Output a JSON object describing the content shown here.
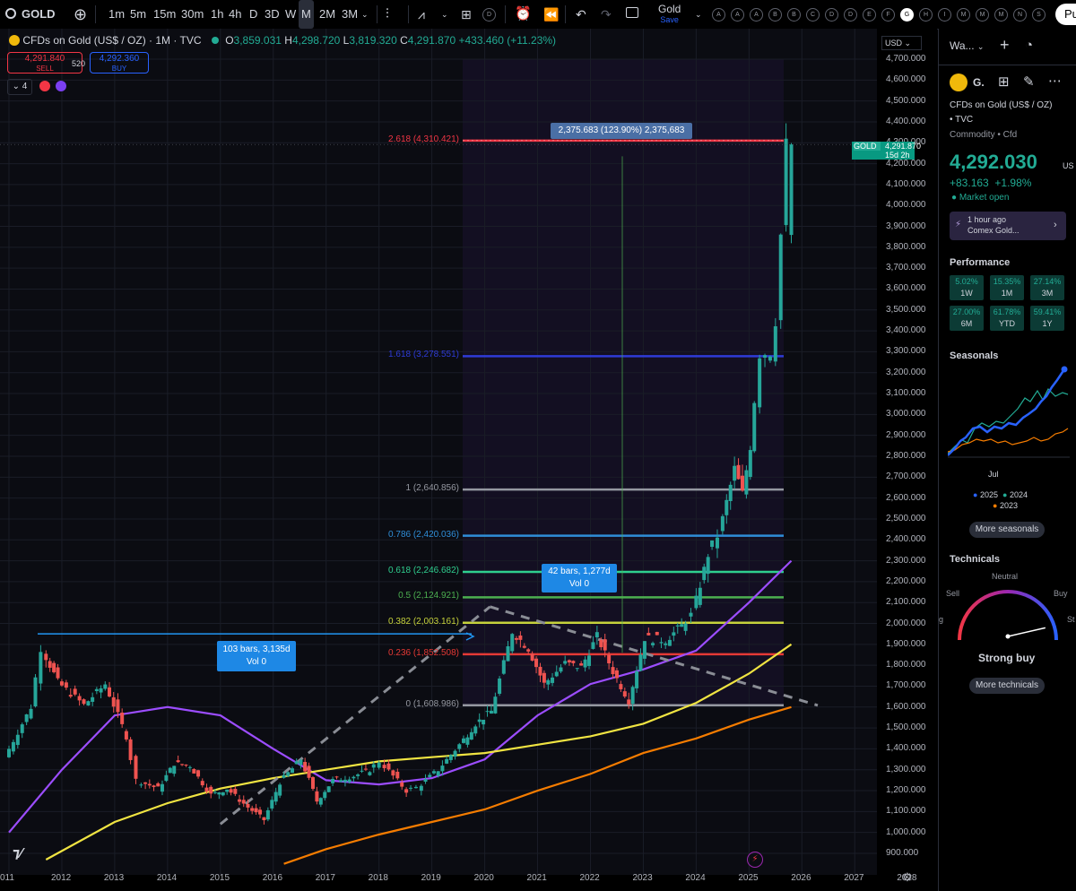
{
  "toolbar": {
    "symbol": "GOLD",
    "intervals": [
      "1m",
      "5m",
      "15m",
      "30m",
      "1h",
      "4h",
      "D",
      "3D",
      "W",
      "M",
      "2M",
      "3M"
    ],
    "active_interval": "M",
    "layout_name": "Gold",
    "layout_status": "Save",
    "alerts_letters": [
      "A",
      "A",
      "A",
      "B",
      "B",
      "C",
      "D",
      "D",
      "E",
      "F",
      "G",
      "H",
      "I",
      "M",
      "M",
      "M",
      "N",
      "S"
    ],
    "active_alert": "G",
    "publish_label": "Pul"
  },
  "legend": {
    "title": "CFDs on Gold (US$ / OZ) · 1M · TVC",
    "o_label": "O",
    "o": "3,859.031",
    "h_label": "H",
    "h": "4,298.720",
    "l_label": "L",
    "l": "3,819.320",
    "c_label": "C",
    "c": "4,291.870",
    "change": "+433.460 (+11.23%)",
    "sell_price": "4,291.840",
    "sell_label": "SELL",
    "spread": "520",
    "buy_price": "4,292.360",
    "buy_label": "BUY",
    "indicator_count": "4"
  },
  "currency": "USD",
  "price_axis": [
    "4,700.000",
    "4,600.000",
    "4,500.000",
    "4,400.000",
    "4,300.000",
    "4,200.000",
    "4,100.000",
    "4,000.000",
    "3,900.000",
    "3,800.000",
    "3,700.000",
    "3,600.000",
    "3,500.000",
    "3,400.000",
    "3,300.000",
    "3,200.000",
    "3,100.000",
    "3,000.000",
    "2,900.000",
    "2,800.000",
    "2,700.000",
    "2,600.000",
    "2,500.000",
    "2,400.000",
    "2,300.000",
    "2,200.000",
    "2,100.000",
    "2,000.000",
    "1,900.000",
    "1,800.000",
    "1,700.000",
    "1,600.000",
    "1,500.000",
    "1,400.000",
    "1,300.000",
    "1,200.000",
    "1,100.000",
    "1,000.000",
    "900.000"
  ],
  "time_axis": [
    "011",
    "2012",
    "2013",
    "2014",
    "2015",
    "2016",
    "2017",
    "2018",
    "2019",
    "2020",
    "2021",
    "2022",
    "2023",
    "2024",
    "2025",
    "2026",
    "2027",
    "2028"
  ],
  "current_price_tag": {
    "symbol": "GOLD",
    "price": "4,291.870",
    "countdown": "15d 2h"
  },
  "fib_levels": [
    {
      "label": "2.618 (4,310.421)",
      "price": 4310.421,
      "color": "#f23645"
    },
    {
      "label": "1.618 (3,278.551)",
      "price": 3278.551,
      "color": "#2e3bd6"
    },
    {
      "label": "1 (2,640.856)",
      "price": 2640.856,
      "color": "#9598a1"
    },
    {
      "label": "0.786 (2,420.036)",
      "price": 2420.036,
      "color": "#2f8ed8"
    },
    {
      "label": "0.618 (2,246.682)",
      "price": 2246.682,
      "color": "#2fcf8f"
    },
    {
      "label": "0.5 (2,124.921)",
      "price": 2124.921,
      "color": "#4caf50"
    },
    {
      "label": "0.382 (2,003.161)",
      "price": 2003.161,
      "color": "#c6d23b"
    },
    {
      "label": "0.236 (1,852.508)",
      "price": 1852.508,
      "color": "#e53935"
    },
    {
      "label": "0 (1,608.986)",
      "price": 1608.986,
      "color": "#9598a1"
    }
  ],
  "measure_top": "2,375.683 (123.90%) 2,375,683",
  "measure_mid": {
    "line1": "42 bars, 1,277d",
    "line2": "Vol 0"
  },
  "measure_left": {
    "line1": "103 bars, 3,135d",
    "line2": "Vol 0"
  },
  "chart_data": {
    "type": "candlestick",
    "interval": "1M",
    "ylim": [
      850,
      4780
    ],
    "xlim": [
      2011.0,
      2028.3
    ],
    "approx_monthly_closes": [
      [
        2011.0,
        1360
      ],
      [
        2011.5,
        1600
      ],
      [
        2011.7,
        1880
      ],
      [
        2012.0,
        1720
      ],
      [
        2012.5,
        1610
      ],
      [
        2012.9,
        1710
      ],
      [
        2013.3,
        1460
      ],
      [
        2013.5,
        1250
      ],
      [
        2013.9,
        1210
      ],
      [
        2014.2,
        1330
      ],
      [
        2014.5,
        1320
      ],
      [
        2014.9,
        1180
      ],
      [
        2015.2,
        1210
      ],
      [
        2015.6,
        1120
      ],
      [
        2015.9,
        1060
      ],
      [
        2016.2,
        1240
      ],
      [
        2016.6,
        1350
      ],
      [
        2016.9,
        1150
      ],
      [
        2017.2,
        1250
      ],
      [
        2017.6,
        1270
      ],
      [
        2017.9,
        1300
      ],
      [
        2018.1,
        1340
      ],
      [
        2018.6,
        1200
      ],
      [
        2018.8,
        1215
      ],
      [
        2019.2,
        1300
      ],
      [
        2019.6,
        1420
      ],
      [
        2019.9,
        1520
      ],
      [
        2020.2,
        1580
      ],
      [
        2020.6,
        1960
      ],
      [
        2020.9,
        1880
      ],
      [
        2021.2,
        1710
      ],
      [
        2021.6,
        1810
      ],
      [
        2021.9,
        1790
      ],
      [
        2022.2,
        1940
      ],
      [
        2022.5,
        1770
      ],
      [
        2022.8,
        1630
      ],
      [
        2023.1,
        1930
      ],
      [
        2023.5,
        1920
      ],
      [
        2023.8,
        1990
      ],
      [
        2024.0,
        2040
      ],
      [
        2024.3,
        2330
      ],
      [
        2024.5,
        2420
      ],
      [
        2024.8,
        2740
      ],
      [
        2024.95,
        2620
      ],
      [
        2025.1,
        2850
      ],
      [
        2025.3,
        3290
      ],
      [
        2025.5,
        3300
      ],
      [
        2025.6,
        3450
      ],
      [
        2025.7,
        3860
      ],
      [
        2025.8,
        4291.87
      ]
    ],
    "moving_averages": [
      {
        "color": "#9c4dff",
        "points": [
          [
            2011.0,
            1000
          ],
          [
            2012.0,
            1300
          ],
          [
            2013.0,
            1560
          ],
          [
            2014.0,
            1600
          ],
          [
            2015.0,
            1560
          ],
          [
            2016.0,
            1400
          ],
          [
            2017.0,
            1250
          ],
          [
            2018.0,
            1230
          ],
          [
            2019.0,
            1260
          ],
          [
            2020.0,
            1350
          ],
          [
            2021.0,
            1560
          ],
          [
            2022.0,
            1710
          ],
          [
            2023.0,
            1780
          ],
          [
            2024.0,
            1870
          ],
          [
            2025.0,
            2100
          ],
          [
            2025.8,
            2300
          ]
        ]
      },
      {
        "color": "#f0e442",
        "points": [
          [
            2011.7,
            870
          ],
          [
            2013.0,
            1050
          ],
          [
            2014.0,
            1140
          ],
          [
            2015.0,
            1210
          ],
          [
            2016.0,
            1260
          ],
          [
            2017.0,
            1300
          ],
          [
            2018.0,
            1340
          ],
          [
            2019.0,
            1360
          ],
          [
            2020.0,
            1380
          ],
          [
            2021.0,
            1420
          ],
          [
            2022.0,
            1460
          ],
          [
            2023.0,
            1520
          ],
          [
            2024.0,
            1620
          ],
          [
            2025.0,
            1760
          ],
          [
            2025.8,
            1900
          ]
        ]
      },
      {
        "color": "#f57c00",
        "points": [
          [
            2016.2,
            850
          ],
          [
            2017.0,
            920
          ],
          [
            2018.0,
            990
          ],
          [
            2019.0,
            1050
          ],
          [
            2020.0,
            1110
          ],
          [
            2021.0,
            1200
          ],
          [
            2022.0,
            1280
          ],
          [
            2023.0,
            1380
          ],
          [
            2024.0,
            1450
          ],
          [
            2025.0,
            1540
          ],
          [
            2025.8,
            1600
          ]
        ]
      }
    ]
  },
  "panel": {
    "watchlist_title": "Wa...",
    "symbol_short": "G.",
    "description": "CFDs on Gold (US$ / OZ)",
    "exchange": "• TVC",
    "category": "Commodity • Cfd",
    "price": "4,292.030",
    "currency": "US",
    "change": "+83.163",
    "change_pct": "+1.98%",
    "market_status": "Market open",
    "news_time": "1 hour ago",
    "news_title": "Comex Gold...",
    "performance_title": "Performance",
    "performance": [
      {
        "value": "5.02%",
        "label": "1W"
      },
      {
        "value": "15.35%",
        "label": "1M"
      },
      {
        "value": "27.14%",
        "label": "3M"
      },
      {
        "value": "27.00%",
        "label": "6M"
      },
      {
        "value": "61.78%",
        "label": "YTD"
      },
      {
        "value": "59.41%",
        "label": "1Y"
      }
    ],
    "seasonals_title": "Seasonals",
    "seasonals_xlabel": "Jul",
    "seasonals_legend": [
      {
        "name": "2025",
        "color": "#2962ff"
      },
      {
        "name": "2024",
        "color": "#22ab94"
      },
      {
        "name": "2023",
        "color": "#f57c00"
      }
    ],
    "more_seasonals": "More seasonals",
    "technicals_title": "Technicals",
    "gauge_neutral": "Neutral",
    "gauge_sell": "Sell",
    "gauge_buy": "Buy",
    "gauge_left_cut": "g",
    "gauge_right_cut": "St",
    "technicals_rating": "Strong buy",
    "gauge_level": 0.9,
    "more_technicals": "More technicals"
  },
  "colors": {
    "up": "#26a69a",
    "down": "#ef5350",
    "accent": "#2962ff",
    "bg": "#000000"
  }
}
